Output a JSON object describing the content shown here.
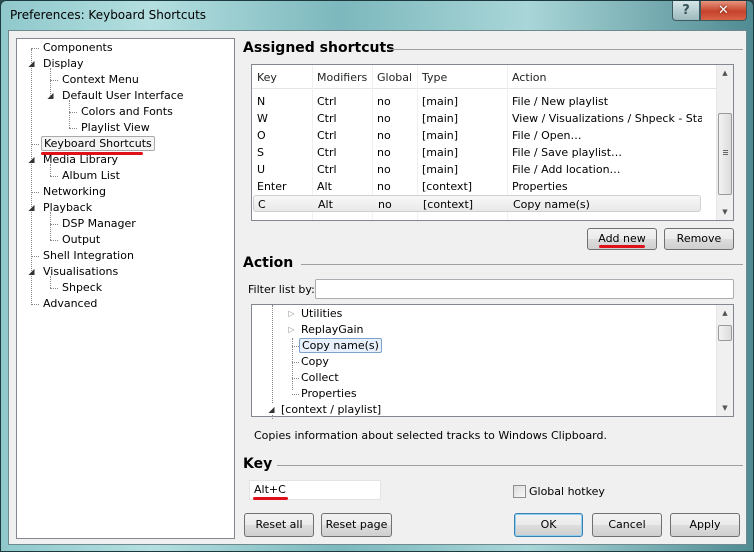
{
  "window": {
    "title": "Preferences: Keyboard Shortcuts",
    "help_glyph": "?",
    "close_glyph": "✕"
  },
  "tree": {
    "items": [
      {
        "label": "Components",
        "level": 0,
        "expander": ""
      },
      {
        "label": "Display",
        "level": 0,
        "expander": "◢"
      },
      {
        "label": "Context Menu",
        "level": 1,
        "expander": ""
      },
      {
        "label": "Default User Interface",
        "level": 1,
        "expander": "◢"
      },
      {
        "label": "Colors and Fonts",
        "level": 2,
        "expander": ""
      },
      {
        "label": "Playlist View",
        "level": 2,
        "expander": ""
      },
      {
        "label": "Keyboard Shortcuts",
        "level": 0,
        "expander": "",
        "selected": true
      },
      {
        "label": "Media Library",
        "level": 0,
        "expander": "◢"
      },
      {
        "label": "Album List",
        "level": 1,
        "expander": ""
      },
      {
        "label": "Networking",
        "level": 0,
        "expander": ""
      },
      {
        "label": "Playback",
        "level": 0,
        "expander": "◢"
      },
      {
        "label": "DSP Manager",
        "level": 1,
        "expander": ""
      },
      {
        "label": "Output",
        "level": 1,
        "expander": ""
      },
      {
        "label": "Shell Integration",
        "level": 0,
        "expander": ""
      },
      {
        "label": "Visualisations",
        "level": 0,
        "expander": "◢"
      },
      {
        "label": "Shpeck",
        "level": 1,
        "expander": ""
      },
      {
        "label": "Advanced",
        "level": 0,
        "expander": ""
      }
    ]
  },
  "assigned": {
    "heading": "Assigned shortcuts",
    "columns": [
      "Key",
      "Modifiers",
      "Global",
      "Type",
      "Action"
    ],
    "rows": [
      [
        "N",
        "Ctrl",
        "no",
        "[main]",
        "File / New playlist"
      ],
      [
        "W",
        "Ctrl",
        "no",
        "[main]",
        "View / Visualizations / Shpeck - Star…"
      ],
      [
        "O",
        "Ctrl",
        "no",
        "[main]",
        "File / Open…"
      ],
      [
        "S",
        "Ctrl",
        "no",
        "[main]",
        "File / Save playlist…"
      ],
      [
        "U",
        "Ctrl",
        "no",
        "[main]",
        "File / Add location…"
      ],
      [
        "Enter",
        "Alt",
        "no",
        "[context]",
        "Properties"
      ],
      [
        "C",
        "Alt",
        "no",
        "[context]",
        "Copy name(s)"
      ]
    ],
    "selected_row": 6,
    "add_new_label": "Add new",
    "remove_label": "Remove"
  },
  "action": {
    "heading": "Action",
    "filter_label": "Filter list by:",
    "filter_value": "",
    "items": [
      {
        "label": "Utilities",
        "expander": "▷",
        "level": 2
      },
      {
        "label": "ReplayGain",
        "expander": "▷",
        "level": 2
      },
      {
        "label": "Copy name(s)",
        "expander": "",
        "level": 2,
        "selected": true
      },
      {
        "label": "Copy",
        "expander": "",
        "level": 2
      },
      {
        "label": "Collect",
        "expander": "",
        "level": 2
      },
      {
        "label": "Properties",
        "expander": "",
        "level": 2
      },
      {
        "label": "[context / playlist]",
        "expander": "◢",
        "level": 1
      }
    ],
    "description": "Copies information about selected tracks to Windows Clipboard."
  },
  "key": {
    "heading": "Key",
    "value": "Alt+C",
    "global_hotkey_label": "Global hotkey",
    "global_hotkey_checked": false
  },
  "footer": {
    "reset_all": "Reset all",
    "reset_page": "Reset page",
    "ok": "OK",
    "cancel": "Cancel",
    "apply": "Apply"
  },
  "scroll_icons": {
    "up": "▲",
    "down": "▼"
  },
  "colors": {
    "highlight_underline": "#e0101a",
    "selection_border": "#7da2ce"
  }
}
